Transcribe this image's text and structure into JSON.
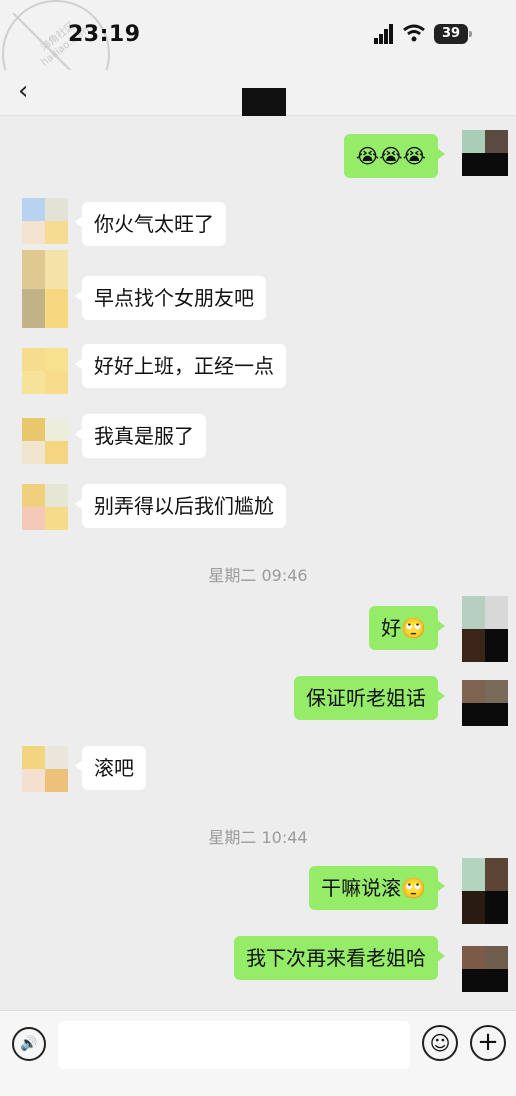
{
  "status": {
    "time": "23:19",
    "battery": "39",
    "watermark": "海角社区 haijiao.com"
  },
  "nav": {
    "back_icon": "chevron-left-icon",
    "back_glyph": "‹"
  },
  "messages": [
    {
      "side": "right",
      "text": "😭😭😭"
    },
    {
      "side": "left",
      "text": "你火气太旺了"
    },
    {
      "side": "left",
      "text": "早点找个女朋友吧"
    },
    {
      "side": "left",
      "text": "好好上班，正经一点"
    },
    {
      "side": "left",
      "text": "我真是服了"
    },
    {
      "side": "left",
      "text": "别弄得以后我们尴尬"
    },
    {
      "side": "time",
      "text": "星期二 09:46"
    },
    {
      "side": "right",
      "text": "好🙄"
    },
    {
      "side": "right",
      "text": "保证听老姐话"
    },
    {
      "side": "left",
      "text": "滚吧"
    },
    {
      "side": "time",
      "text": "星期二 10:44"
    },
    {
      "side": "right",
      "text": "干嘛说滚🙄"
    },
    {
      "side": "right",
      "text": "我下次再来看老姐哈"
    }
  ],
  "input": {
    "voice_glyph": "🔊",
    "emoji_glyph": "☺",
    "plus_glyph": "+"
  },
  "colors": {
    "background": "#ededed",
    "bubble_right": "#95ec69",
    "bubble_left": "#ffffff",
    "timestamp": "#9b9b9b"
  }
}
